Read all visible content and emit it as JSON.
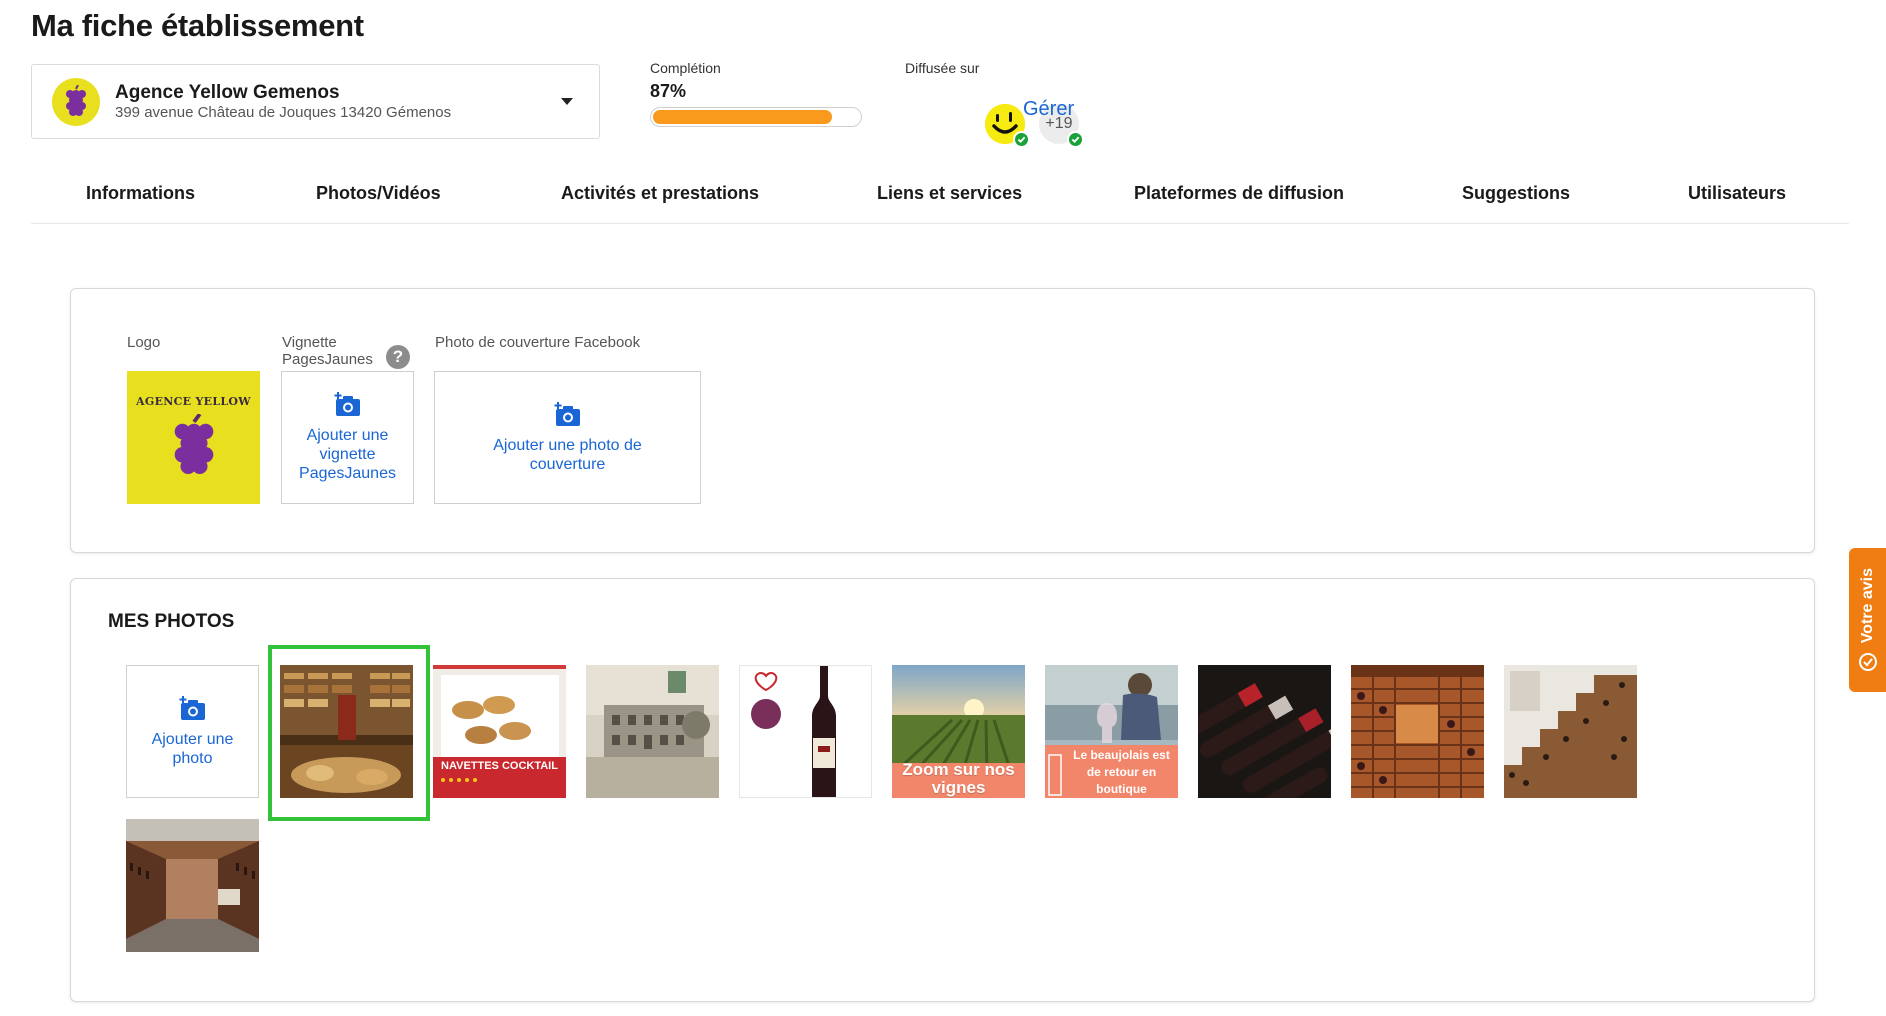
{
  "page": {
    "title": "Ma fiche établissement"
  },
  "establishment": {
    "name": "Agence Yellow Gemenos",
    "address": "399 avenue Château de Jouques 13420 Gémenos",
    "dropdown_icon": "chevron-down-icon"
  },
  "completion": {
    "label": "Complétion",
    "value_text": "87%",
    "percent": 87,
    "bar_color": "#fa9a1c"
  },
  "diffusion": {
    "label": "Diffusée sur",
    "extra_count": "+19",
    "manage_label": "Gérer",
    "check_color": "#1aa23a"
  },
  "tabs": [
    {
      "label": "Informations"
    },
    {
      "label": "Photos/Vidéos"
    },
    {
      "label": "Activités et prestations"
    },
    {
      "label": "Liens et services"
    },
    {
      "label": "Plateformes de diffusion"
    },
    {
      "label": "Suggestions"
    },
    {
      "label": "Utilisateurs"
    }
  ],
  "media": {
    "logo_label": "Logo",
    "logo_text": "AGENCE YELLOW",
    "thumbnail_label": "Vignette PagesJaunes",
    "thumbnail_help": "?",
    "thumbnail_add": "Ajouter une vignette PagesJaunes",
    "cover_label": "Photo de couverture Facebook",
    "cover_add": "Ajouter une photo de couverture"
  },
  "photos": {
    "section_title": "MES PHOTOS",
    "add_label": "Ajouter une photo",
    "items": [
      {
        "name": "photo-shop-interior",
        "selected": true
      },
      {
        "name": "photo-navettes-cocktail",
        "caption": "NAVETTES COCKTAIL"
      },
      {
        "name": "photo-old-postcard"
      },
      {
        "name": "photo-wine-bottle"
      },
      {
        "name": "photo-vineyard",
        "caption": "Zoom sur nos vignes"
      },
      {
        "name": "photo-beaujolais",
        "caption": "Le beaujolais est de retour en boutique"
      },
      {
        "name": "photo-bottles-rack"
      },
      {
        "name": "photo-wine-cellar"
      },
      {
        "name": "photo-cellar-stairs"
      },
      {
        "name": "photo-shop-aisle"
      }
    ]
  },
  "side_tab": {
    "label": "Votre avis"
  },
  "colors": {
    "link": "#1a66d4",
    "accent": "#f07d12",
    "selected_border": "#33c23a",
    "brand_yellow": "#e8e01f"
  }
}
